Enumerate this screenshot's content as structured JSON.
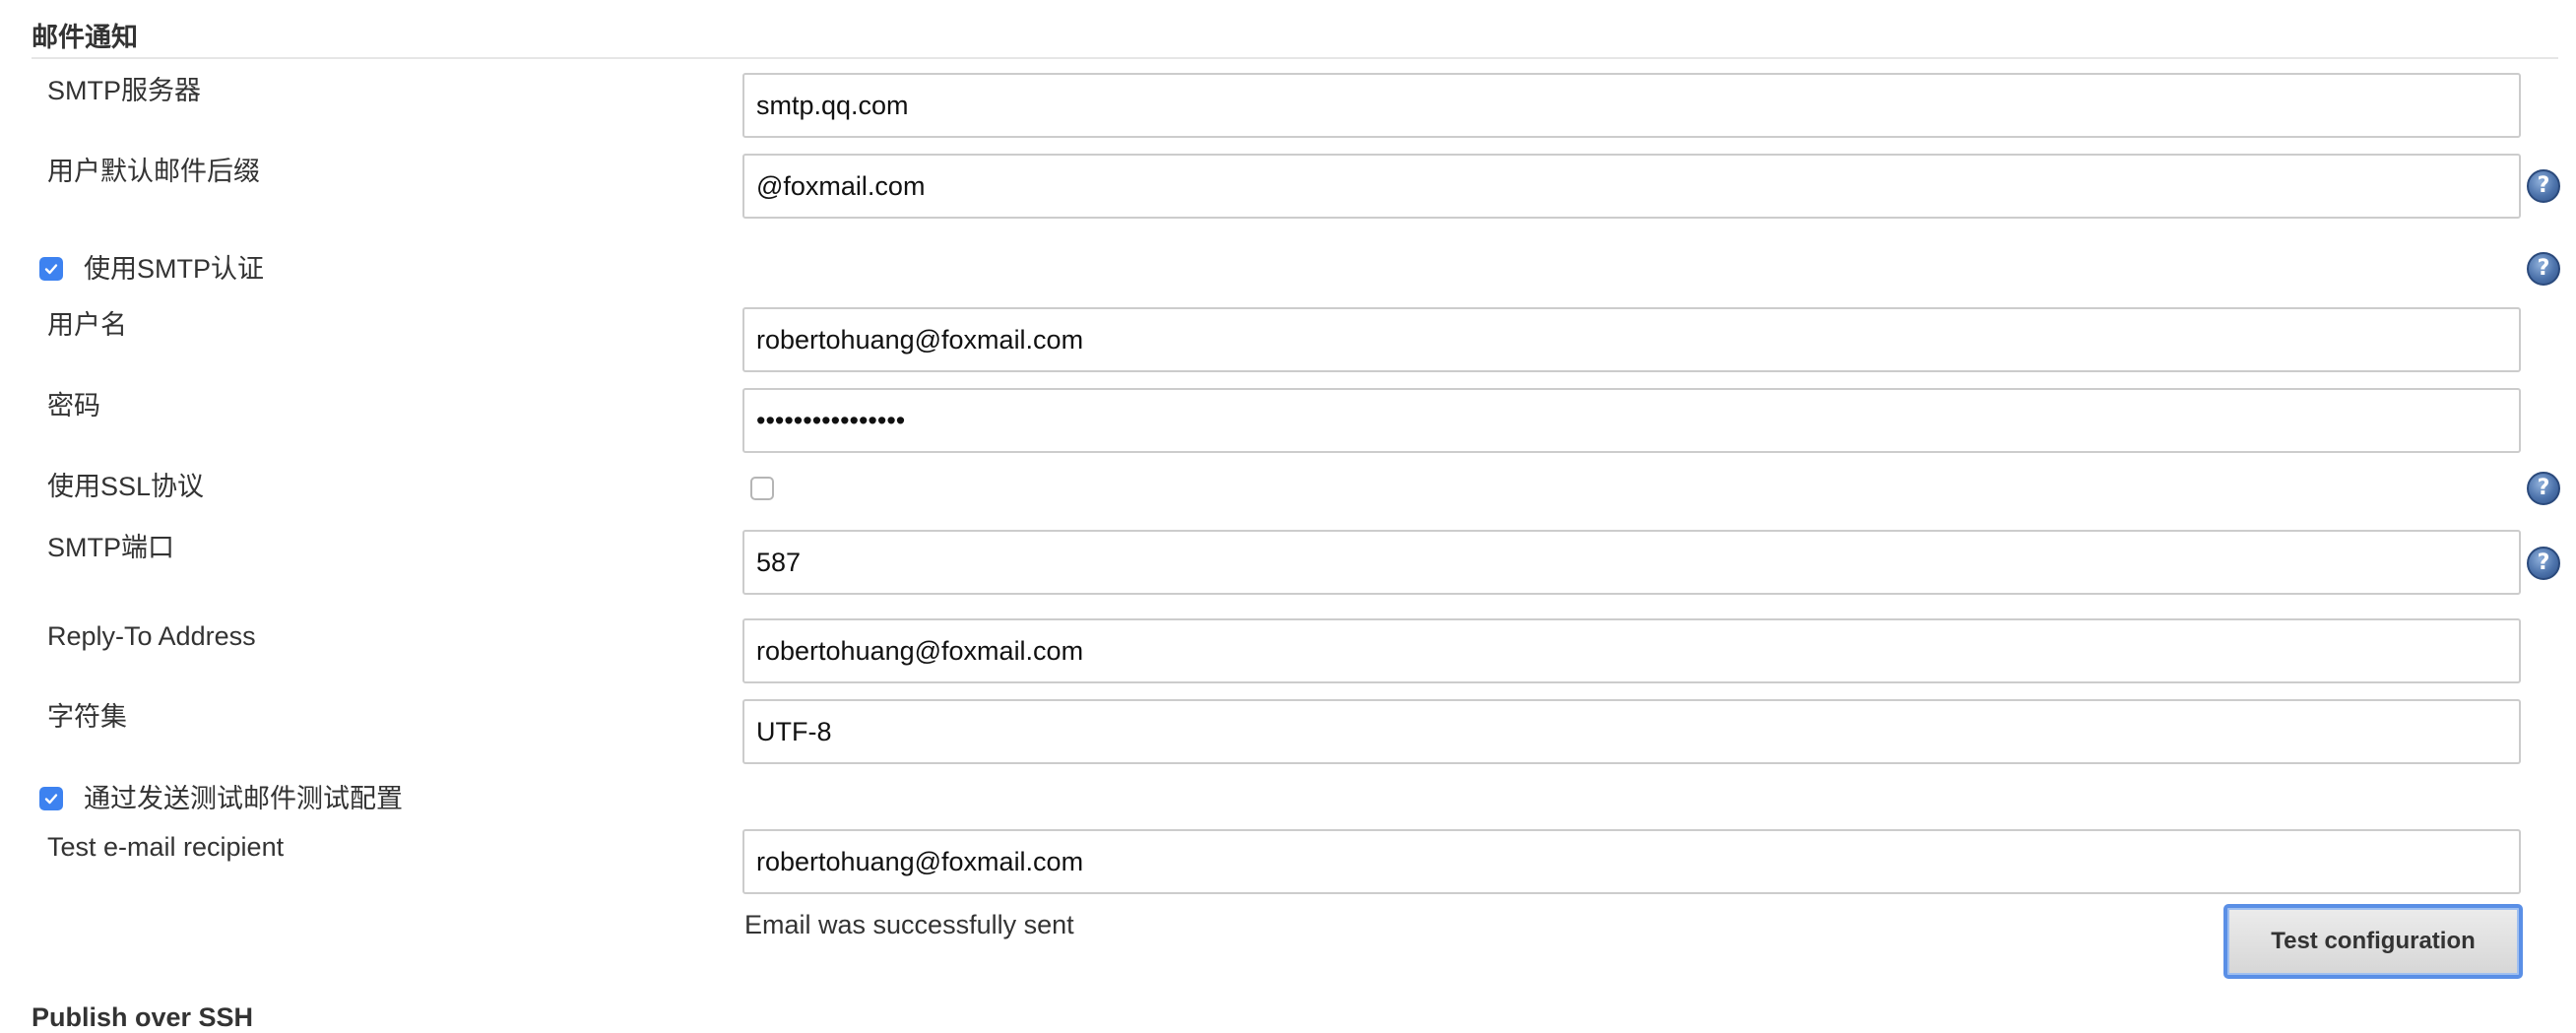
{
  "section": {
    "title": "邮件通知"
  },
  "smtp_server": {
    "label": "SMTP服务器",
    "value": "smtp.qq.com"
  },
  "default_suffix": {
    "label": "用户默认邮件后缀",
    "value": "@foxmail.com"
  },
  "use_smtp_auth": {
    "label": "使用SMTP认证",
    "checked": true
  },
  "username": {
    "label": "用户名",
    "value": "robertohuang@foxmail.com"
  },
  "password": {
    "label": "密码",
    "value": "••••••••••••••••"
  },
  "use_ssl": {
    "label": "使用SSL协议",
    "checked": false
  },
  "smtp_port": {
    "label": "SMTP端口",
    "value": "587"
  },
  "reply_to": {
    "label": "Reply-To Address",
    "value": "robertohuang@foxmail.com"
  },
  "charset": {
    "label": "字符集",
    "value": "UTF-8"
  },
  "test_by_email": {
    "label": "通过发送测试邮件测试配置",
    "checked": true
  },
  "test_recipient": {
    "label": "Test e-mail recipient",
    "value": "robertohuang@foxmail.com"
  },
  "status": {
    "message": "Email was successfully sent"
  },
  "buttons": {
    "test_configuration": "Test configuration"
  },
  "help": {
    "glyph": "?",
    "icon": "help-icon"
  },
  "next_section": {
    "title": "Publish over SSH"
  },
  "colors": {
    "accent": "#3d82f0",
    "border": "#cccccc",
    "help": "#4d73ab"
  }
}
